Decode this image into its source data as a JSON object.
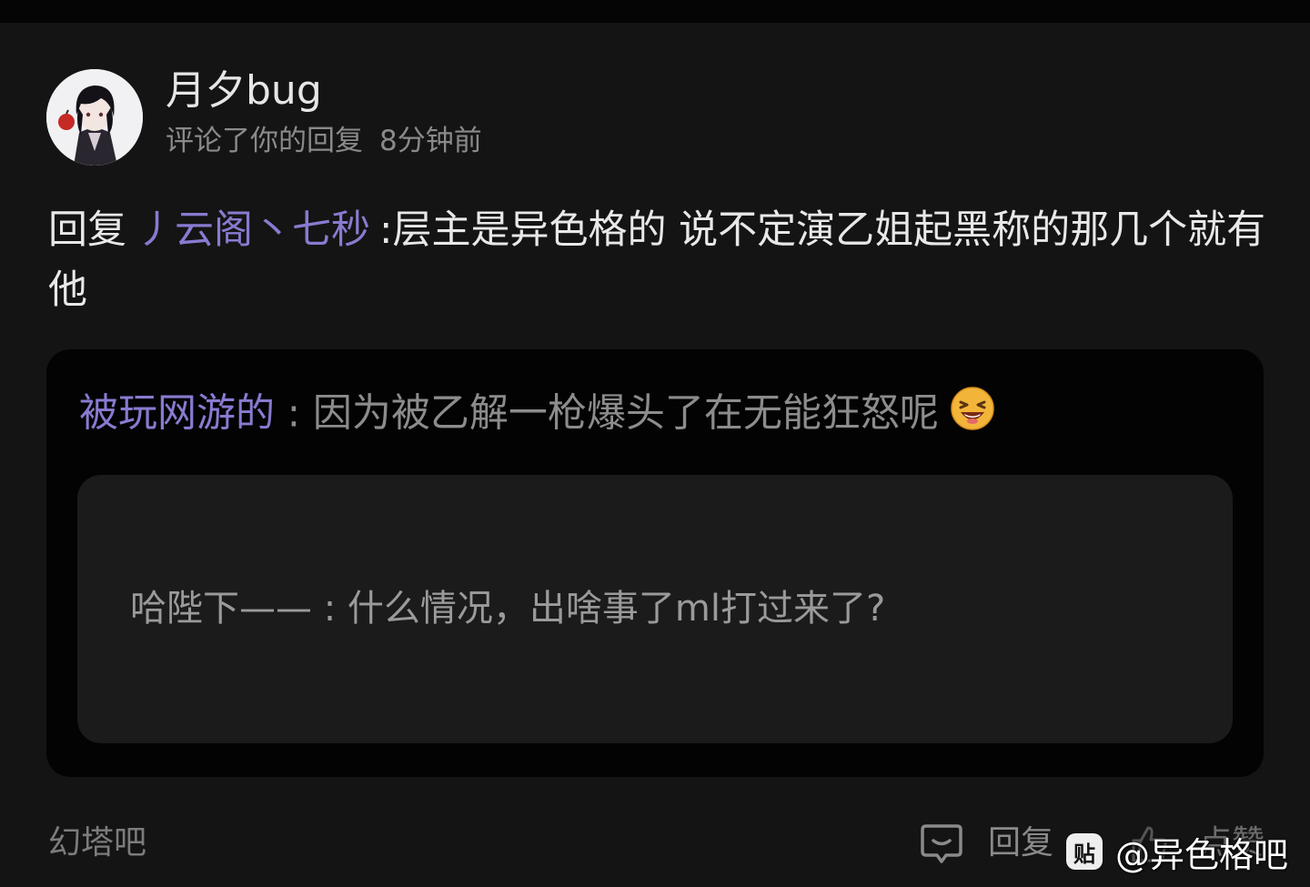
{
  "post": {
    "username": "月夕bug",
    "action": "评论了你的回复",
    "time": "8分钟前",
    "reply_prefix": "回复",
    "mention": "丿云阁丶七秒",
    "content": ":层主是异色格的 说不定演乙姐起黑称的那几个就有他"
  },
  "quote": {
    "author": "被玩网游的",
    "separator": " : ",
    "text": "因为被乙解一枪爆头了在无能狂怒呢",
    "emoji_icon": "laughing-emoji-icon",
    "nested": {
      "author": "哈陛下——",
      "separator": " : ",
      "text": "什么情况，出啥事了ml打过来了?"
    }
  },
  "footer": {
    "forum": "幻塔吧",
    "reply_label": "回复",
    "like_label": "点赞"
  },
  "watermark": {
    "logo_text": "贴",
    "text": "@异色格吧"
  },
  "colors": {
    "background": "#141414",
    "card": "#030303",
    "inner_card": "#1b1b1b",
    "mention": "#8a7ad0"
  }
}
